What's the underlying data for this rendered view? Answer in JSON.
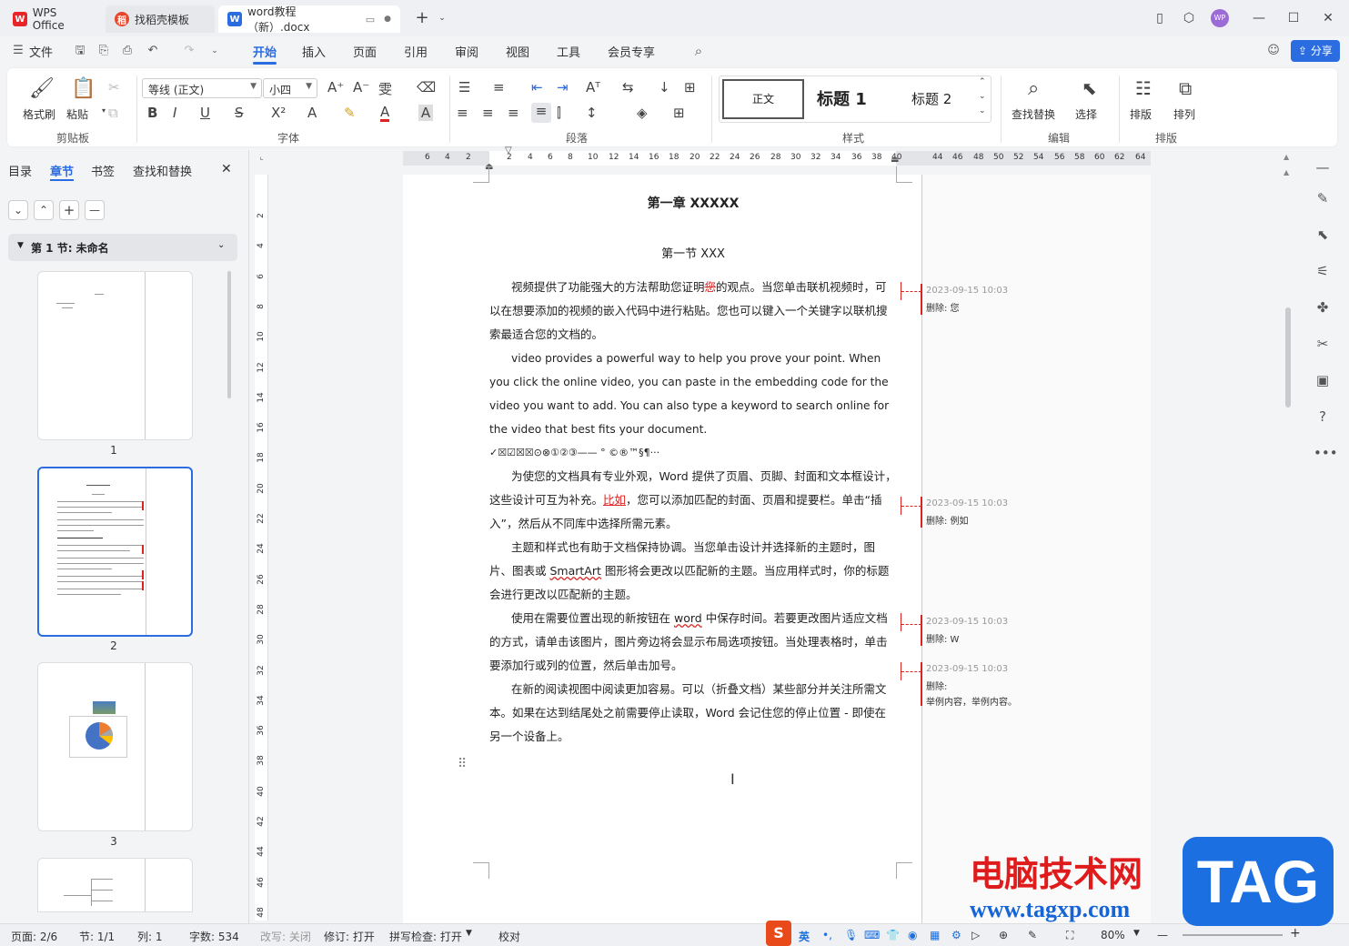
{
  "titlebar": {
    "tabs": [
      {
        "label": "WPS Office"
      },
      {
        "label": "找稻壳模板"
      },
      {
        "label": "word教程（新）.docx"
      }
    ],
    "user_avatar": "WP"
  },
  "menubar": {
    "file": "文件",
    "items": [
      "开始",
      "插入",
      "页面",
      "引用",
      "审阅",
      "视图",
      "工具",
      "会员专享"
    ],
    "share": "分享"
  },
  "ribbon": {
    "clipboard": {
      "format_painter": "格式刷",
      "paste": "粘贴",
      "group": "剪贴板"
    },
    "font": {
      "name": "等线 (正文)",
      "size": "小四",
      "group": "字体"
    },
    "paragraph": {
      "group": "段落"
    },
    "styles": {
      "normal": "正文",
      "h1": "标题  1",
      "h2": "标题  2",
      "group": "样式"
    },
    "edit": {
      "find_replace": "查找替换",
      "select": "选择",
      "group": "编辑"
    },
    "layout": {
      "arrange": "排版",
      "order": "排列",
      "group": "排版"
    }
  },
  "leftpanel": {
    "tabs": [
      "目录",
      "章节",
      "书签",
      "查找和替换"
    ],
    "section": "第 1 节: 未命名",
    "pages": [
      "1",
      "2",
      "3"
    ]
  },
  "ruler": {
    "h": [
      "6",
      "4",
      "2",
      "2",
      "4",
      "6",
      "8",
      "10",
      "12",
      "14",
      "16",
      "18",
      "20",
      "22",
      "24",
      "26",
      "28",
      "30",
      "32",
      "34",
      "36",
      "38",
      "40",
      "44",
      "46",
      "48",
      "50",
      "52",
      "54",
      "56",
      "58",
      "60",
      "62",
      "64"
    ],
    "v": [
      "2",
      "4",
      "6",
      "8",
      "10",
      "12",
      "14",
      "16",
      "18",
      "20",
      "22",
      "24",
      "26",
      "28",
      "30",
      "32",
      "34",
      "36",
      "38",
      "40",
      "42",
      "44",
      "46",
      "48"
    ]
  },
  "document": {
    "chapter": "第一章  XXXXX",
    "section": "第一节  XXX",
    "p1a": "视频提供了功能强大的方法帮助您证明",
    "p1del": "您",
    "p1b": "的观点。当您单击联机视频时，可以在想要添加的视频的嵌入代码中进行粘贴。您也可以键入一个关键字以联机搜索最适合您的文档的。",
    "p2": "video provides a powerful way to help you prove your point. When you click the online video, you can paste in the embedding code for the video you want to add. You can also type a keyword to search online for the video that best fits your document.",
    "symbols": "✓☒☑☒☒⊙⊗①②③——    °   ©®™§¶···",
    "p3a": "为使您的文档具有专业外观，Word 提供了页眉、页脚、封面和文本框设计，这些设计可互为补充。",
    "p3del": "比如",
    "p3b": "，您可以添加匹配的封面、页眉和提要栏。单击“插入”，然后从不同库中选择所需元素。",
    "p4a": "主题和样式也有助于文档保持协调。当您单击设计并选择新的主题时，图片、图表或 ",
    "p4smart": "SmartArt",
    "p4b": " 图形将会更改以匹配新的主题。当应用样式时，你的标题会进行更改以匹配新的主题。",
    "p5a": "使用在需要位置出现的新按钮在 ",
    "p5word": "word",
    "p5b": " 中保存时间。若要更改图片适应文档的方式，请单击该图片，图片旁边将会显示布局选项按钮。当处理表格时，单击要添加行或列的位置，然后单击加号。",
    "p6": "在新的阅读视图中阅读更加容易。可以（折叠文档）某些部分并关注所需文本。如果在达到结尾处之前需要停止读取，Word 会记住您的停止位置 - 即使在另一个设备上。"
  },
  "comments": [
    {
      "time": "2023-09-15 10:03",
      "text": "删除: 您"
    },
    {
      "time": "2023-09-15 10:03",
      "text": "删除: 例如"
    },
    {
      "time": "2023-09-15 10:03",
      "text": "删除: W"
    },
    {
      "time": "2023-09-15 10:03",
      "text": "删除:",
      "text2": "举例内容，举例内容。"
    }
  ],
  "statusbar": {
    "page": "页面: 2/6",
    "section": "节: 1/1",
    "col": "列: 1",
    "words": "字数: 534",
    "rewrite": "改写: 关闭",
    "track": "修订: 打开",
    "spell": "拼写检查: 打开",
    "proof": "校对",
    "ime": "英",
    "zoom": "80%"
  },
  "watermark": {
    "text": "电脑技术网",
    "url": "www.tagxp.com",
    "tag": "TAG"
  },
  "colors": {
    "accent": "#2b6de0",
    "track": "#dd2222"
  }
}
